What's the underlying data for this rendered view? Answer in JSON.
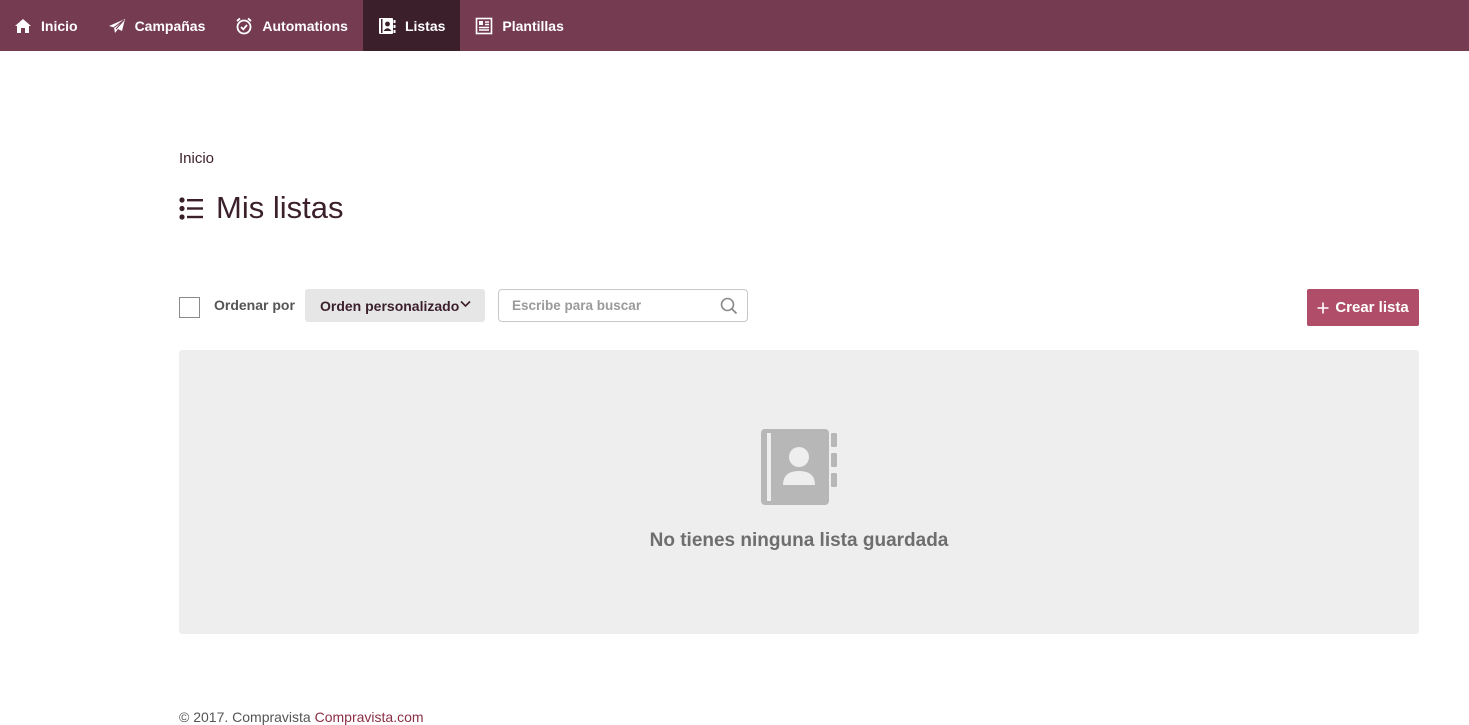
{
  "nav": {
    "items": [
      {
        "label": "Inicio",
        "icon": "home-icon"
      },
      {
        "label": "Campañas",
        "icon": "paper-plane-icon"
      },
      {
        "label": "Automations",
        "icon": "alarm-clock-icon"
      },
      {
        "label": "Listas",
        "icon": "address-book-icon",
        "active": true
      },
      {
        "label": "Plantillas",
        "icon": "template-icon"
      }
    ]
  },
  "breadcrumb": "Inicio",
  "page_title": "Mis listas",
  "toolbar": {
    "sort_label": "Ordenar por",
    "sort_value": "Orden personalizado",
    "search_placeholder": "Escribe para buscar",
    "create_button": "Crear lista"
  },
  "empty_state": {
    "message": "No tienes ninguna lista guardada",
    "icon": "address-book-icon"
  },
  "footer": {
    "copyright": "© 2017. Compravista",
    "link": "Compravista.com"
  },
  "colors": {
    "nav_bg": "#743b51",
    "nav_active_bg": "#3b1f2b",
    "accent_button": "#b04d68",
    "footer_link": "#8c2f45"
  }
}
